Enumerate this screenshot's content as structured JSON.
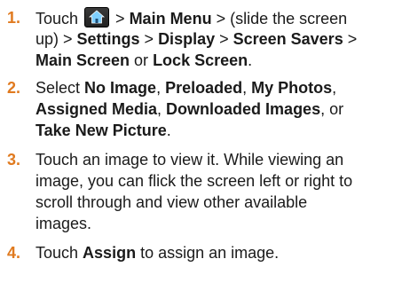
{
  "steps": [
    {
      "number": "1.",
      "lines": [
        [
          "Touch ",
          "{home-icon}",
          " > ",
          "**Main Menu**",
          " > (slide the screen"
        ],
        [
          "up) > ",
          "**Settings**",
          " > ",
          "**Display**",
          " > ",
          "**Screen Savers**",
          " >"
        ],
        [
          "**Main Screen**",
          " or ",
          "**Lock Screen**",
          "."
        ]
      ]
    },
    {
      "number": "2.",
      "lines": [
        [
          "Select ",
          "**No Image**",
          ", ",
          "**Preloaded**",
          ", ",
          "**My Photos**",
          ","
        ],
        [
          "**Assigned Media**",
          ", ",
          "**Downloaded Images**",
          ", or"
        ],
        [
          "**Take New Picture**",
          "."
        ]
      ]
    },
    {
      "number": "3.",
      "lines": [
        [
          "Touch an image to view it. While viewing an"
        ],
        [
          "image, you can flick the screen left or right to"
        ],
        [
          "scroll through and view other available"
        ],
        [
          "images."
        ]
      ]
    },
    {
      "number": "4.",
      "lines": [
        [
          " Touch ",
          "**Assign**",
          " to assign an image."
        ]
      ]
    }
  ],
  "colors": {
    "step_number": "#e07a1f",
    "body_text": "#1a1a1a",
    "icon_background": "#222222",
    "icon_house": "#7fd0ff"
  },
  "icons": {
    "home": "home-icon"
  }
}
